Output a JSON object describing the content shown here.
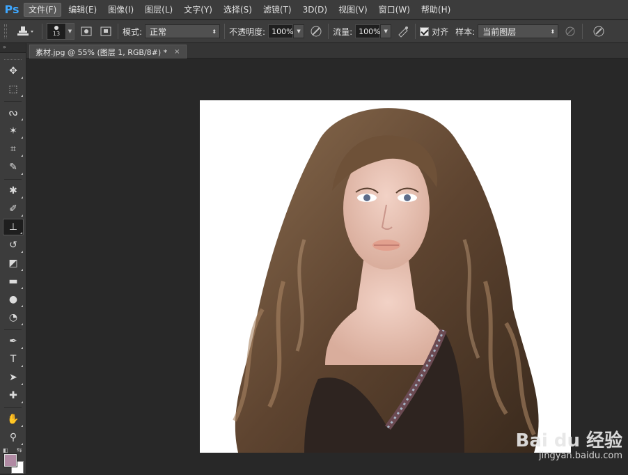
{
  "app": {
    "logo": "Ps"
  },
  "menu": [
    {
      "label": "文件(F)",
      "active": true
    },
    {
      "label": "编辑(E)"
    },
    {
      "label": "图像(I)"
    },
    {
      "label": "图层(L)"
    },
    {
      "label": "文字(Y)"
    },
    {
      "label": "选择(S)"
    },
    {
      "label": "滤镜(T)"
    },
    {
      "label": "3D(D)"
    },
    {
      "label": "视图(V)"
    },
    {
      "label": "窗口(W)"
    },
    {
      "label": "帮助(H)"
    }
  ],
  "options": {
    "brush_size": "13",
    "mode_label": "模式:",
    "mode_value": "正常",
    "opacity_label": "不透明度:",
    "opacity_value": "100%",
    "flow_label": "流量:",
    "flow_value": "100%",
    "align_label": "对齐",
    "align_checked": true,
    "sample_label": "样本:",
    "sample_value": "当前图层"
  },
  "document_tab": {
    "title": "素材.jpg @ 55% (图层 1, RGB/8#) *",
    "close": "×"
  },
  "tools": [
    {
      "name": "move-tool",
      "glyph": "✥"
    },
    {
      "name": "marquee-tool",
      "glyph": "⬚"
    },
    {
      "name": "lasso-tool",
      "glyph": "ᔓ"
    },
    {
      "name": "magic-wand-tool",
      "glyph": "✶"
    },
    {
      "name": "crop-tool",
      "glyph": "⌗"
    },
    {
      "name": "eyedropper-tool",
      "glyph": "✎"
    },
    {
      "name": "healing-brush-tool",
      "glyph": "✱"
    },
    {
      "name": "brush-tool",
      "glyph": "✐"
    },
    {
      "name": "clone-stamp-tool",
      "glyph": "⊥",
      "selected": true
    },
    {
      "name": "history-brush-tool",
      "glyph": "↺"
    },
    {
      "name": "eraser-tool",
      "glyph": "◩"
    },
    {
      "name": "gradient-tool",
      "glyph": "▬"
    },
    {
      "name": "blur-tool",
      "glyph": "●"
    },
    {
      "name": "dodge-tool",
      "glyph": "◔"
    },
    {
      "name": "pen-tool",
      "glyph": "✒"
    },
    {
      "name": "type-tool",
      "glyph": "T"
    },
    {
      "name": "path-selection-tool",
      "glyph": "➤"
    },
    {
      "name": "shape-tool",
      "glyph": "✚"
    },
    {
      "name": "hand-tool",
      "glyph": "✋"
    },
    {
      "name": "zoom-tool",
      "glyph": "⚲"
    }
  ],
  "colors": {
    "foreground": "#b08aa3",
    "background": "#ffffff"
  },
  "watermark": {
    "logo": "Bai du 经验",
    "url": "jingyan.baidu.com"
  }
}
